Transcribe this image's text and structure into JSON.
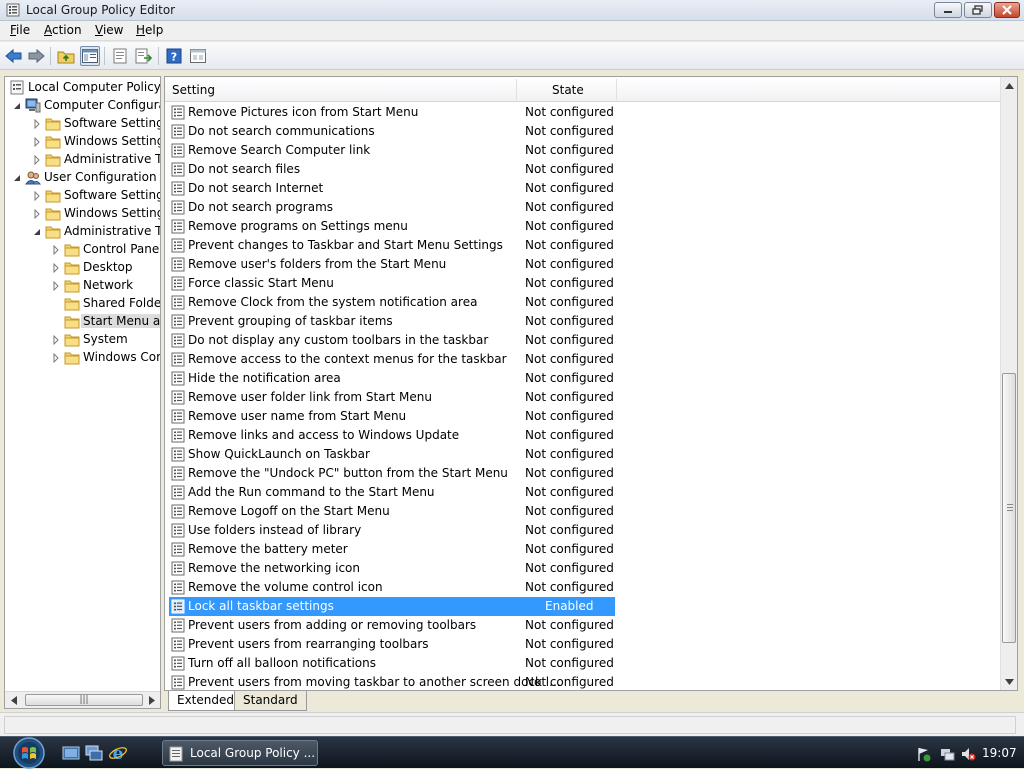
{
  "window": {
    "title": "Local Group Policy Editor"
  },
  "menu": {
    "items": [
      {
        "label": "File",
        "accel": "F"
      },
      {
        "label": "Action",
        "accel": "A"
      },
      {
        "label": "View",
        "accel": "V"
      },
      {
        "label": "Help",
        "accel": "H"
      }
    ]
  },
  "toolbar": {
    "buttons": [
      "back-icon",
      "forward-icon",
      "up-folder-icon",
      "show-hide-tree-icon",
      "properties-icon",
      "export-list-icon",
      "help-icon",
      "console-icon"
    ]
  },
  "tree": {
    "items": [
      {
        "label": "Local Computer Policy",
        "level": 0,
        "expander": "none",
        "icon": "policy-icon"
      },
      {
        "label": "Computer Configuration",
        "level": 1,
        "expander": "open",
        "icon": "computer-icon"
      },
      {
        "label": "Software Settings",
        "level": 2,
        "expander": "closed",
        "icon": "folder-icon"
      },
      {
        "label": "Windows Settings",
        "level": 2,
        "expander": "closed",
        "icon": "folder-icon"
      },
      {
        "label": "Administrative Templates",
        "level": 2,
        "expander": "closed",
        "icon": "folder-icon"
      },
      {
        "label": "User Configuration",
        "level": 1,
        "expander": "open",
        "icon": "users-icon"
      },
      {
        "label": "Software Settings",
        "level": 2,
        "expander": "closed",
        "icon": "folder-icon"
      },
      {
        "label": "Windows Settings",
        "level": 2,
        "expander": "closed",
        "icon": "folder-icon"
      },
      {
        "label": "Administrative Templates",
        "level": 2,
        "expander": "open",
        "icon": "folder-icon"
      },
      {
        "label": "Control Panel",
        "level": 3,
        "expander": "closed",
        "icon": "folder-icon"
      },
      {
        "label": "Desktop",
        "level": 3,
        "expander": "closed",
        "icon": "folder-icon"
      },
      {
        "label": "Network",
        "level": 3,
        "expander": "closed",
        "icon": "folder-icon"
      },
      {
        "label": "Shared Folders",
        "level": 3,
        "expander": "none",
        "icon": "folder-icon"
      },
      {
        "label": "Start Menu and Taskbar",
        "level": 3,
        "expander": "none",
        "icon": "folder-icon",
        "selected": true
      },
      {
        "label": "System",
        "level": 3,
        "expander": "closed",
        "icon": "folder-icon"
      },
      {
        "label": "Windows Components",
        "level": 3,
        "expander": "closed",
        "icon": "folder-icon"
      }
    ]
  },
  "details": {
    "columns": {
      "setting": "Setting",
      "state": "State"
    },
    "rows": [
      {
        "setting": "Remove Pictures icon from Start Menu",
        "state": "Not configured"
      },
      {
        "setting": "Do not search communications",
        "state": "Not configured"
      },
      {
        "setting": "Remove Search Computer link",
        "state": "Not configured"
      },
      {
        "setting": "Do not search files",
        "state": "Not configured"
      },
      {
        "setting": "Do not search Internet",
        "state": "Not configured"
      },
      {
        "setting": "Do not search programs",
        "state": "Not configured"
      },
      {
        "setting": "Remove programs on Settings menu",
        "state": "Not configured"
      },
      {
        "setting": "Prevent changes to Taskbar and Start Menu Settings",
        "state": "Not configured"
      },
      {
        "setting": "Remove user's folders from the Start Menu",
        "state": "Not configured"
      },
      {
        "setting": "Force classic Start Menu",
        "state": "Not configured"
      },
      {
        "setting": "Remove Clock from the system notification area",
        "state": "Not configured"
      },
      {
        "setting": "Prevent grouping of taskbar items",
        "state": "Not configured"
      },
      {
        "setting": "Do not display any custom toolbars in the taskbar",
        "state": "Not configured"
      },
      {
        "setting": "Remove access to the context menus for the taskbar",
        "state": "Not configured"
      },
      {
        "setting": "Hide the notification area",
        "state": "Not configured"
      },
      {
        "setting": "Remove user folder link from Start Menu",
        "state": "Not configured"
      },
      {
        "setting": "Remove user name from Start Menu",
        "state": "Not configured"
      },
      {
        "setting": "Remove links and access to Windows Update",
        "state": "Not configured"
      },
      {
        "setting": "Show QuickLaunch on Taskbar",
        "state": "Not configured"
      },
      {
        "setting": "Remove the \"Undock PC\" button from the Start Menu",
        "state": "Not configured"
      },
      {
        "setting": "Add the Run command to the Start Menu",
        "state": "Not configured"
      },
      {
        "setting": "Remove Logoff on the Start Menu",
        "state": "Not configured"
      },
      {
        "setting": "Use folders instead of library",
        "state": "Not configured"
      },
      {
        "setting": "Remove the battery meter",
        "state": "Not configured"
      },
      {
        "setting": "Remove the networking icon",
        "state": "Not configured"
      },
      {
        "setting": "Remove the volume control icon",
        "state": "Not configured"
      },
      {
        "setting": "Lock all taskbar settings",
        "state": "Enabled",
        "selected": true
      },
      {
        "setting": "Prevent users from adding or removing toolbars",
        "state": "Not configured"
      },
      {
        "setting": "Prevent users from rearranging toolbars",
        "state": "Not configured"
      },
      {
        "setting": "Turn off all balloon notifications",
        "state": "Not configured"
      },
      {
        "setting": "Prevent users from moving taskbar to another screen dock l...",
        "state": "Not configured"
      }
    ]
  },
  "tabs": [
    {
      "label": "Extended",
      "active": true
    },
    {
      "label": "Standard",
      "active": false
    }
  ],
  "taskbar": {
    "task_label": "Local Group Policy ...",
    "clock": "19:07"
  },
  "colors": {
    "selection": "#3399ff",
    "taskbar": "#1b2530"
  }
}
